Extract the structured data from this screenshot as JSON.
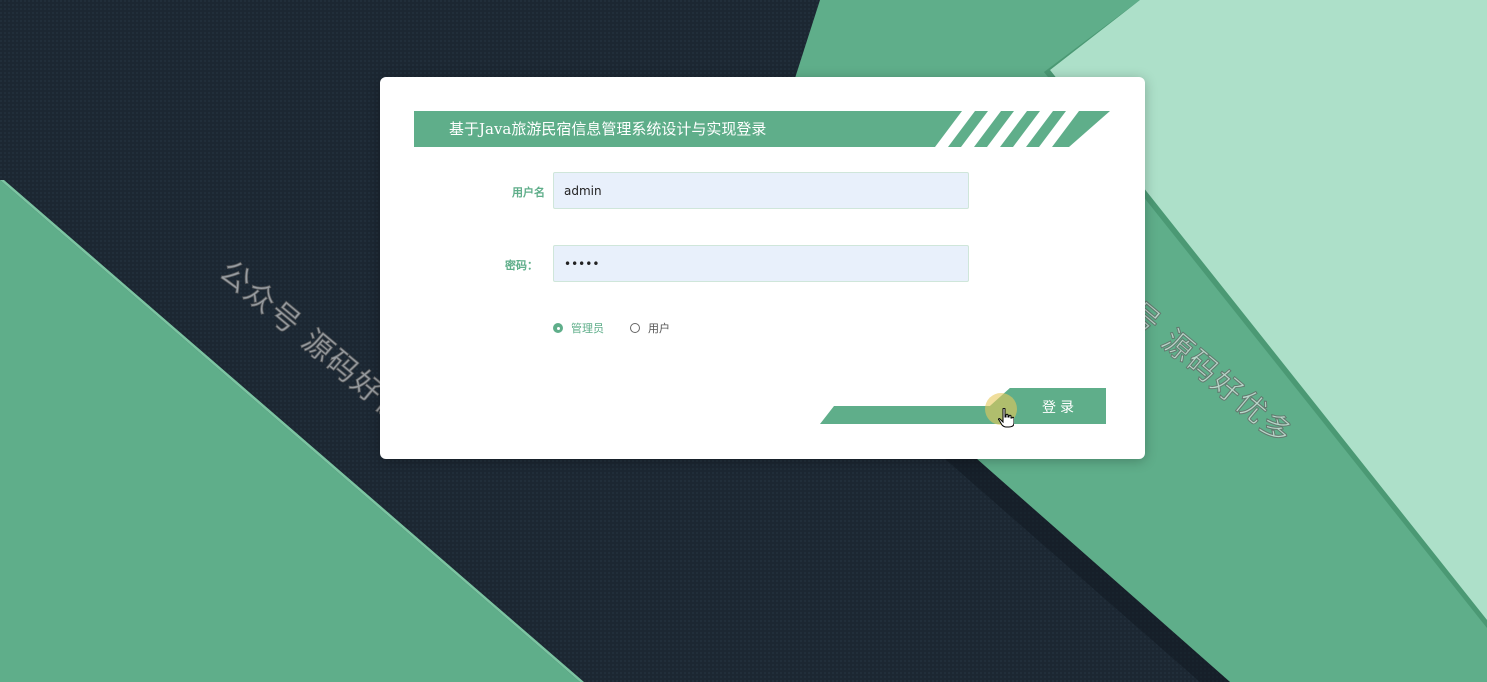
{
  "page": {
    "title": "基于Java旅游民宿信息管理系统设计与实现登录"
  },
  "form": {
    "username_label": "用户名",
    "username_value": "admin",
    "password_label": "密码：",
    "password_value": "•••••",
    "roles": [
      {
        "label": "管理员",
        "checked": true
      },
      {
        "label": "用户",
        "checked": false
      }
    ],
    "login_label": "登录"
  },
  "watermark": {
    "text": "公众号 源码好优多"
  },
  "colors": {
    "accent": "#5fae8a",
    "dark_bg": "#1b2631",
    "light_green": "#ade0c9",
    "input_bg": "#e8f0fb"
  },
  "icons": {
    "cursor": "hand-pointer-icon"
  }
}
